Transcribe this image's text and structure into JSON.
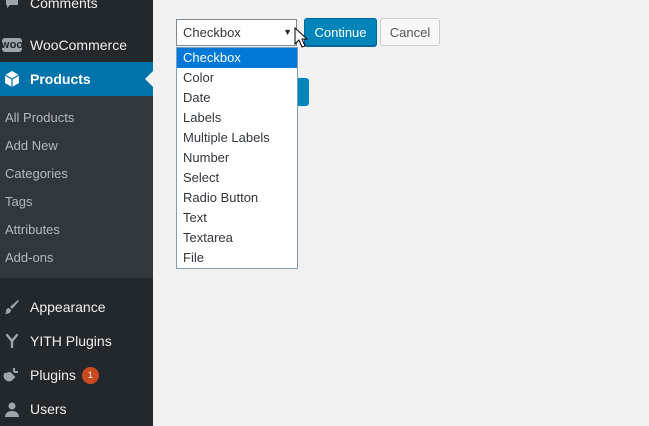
{
  "sidebar": {
    "comments_label": "Comments",
    "woocommerce_label": "WooCommerce",
    "woo_icon_text": "WOO",
    "products_label": "Products",
    "submenu": [
      "All Products",
      "Add New",
      "Categories",
      "Tags",
      "Attributes",
      "Add-ons"
    ],
    "appearance_label": "Appearance",
    "yith_label": "YITH Plugins",
    "plugins_label": "Plugins",
    "plugins_badge": "1",
    "users_label": "Users"
  },
  "form": {
    "select_value": "Checkbox",
    "continue_label": "Continue",
    "cancel_label": "Cancel",
    "options": [
      "Checkbox",
      "Color",
      "Date",
      "Labels",
      "Multiple Labels",
      "Number",
      "Select",
      "Radio Button",
      "Text",
      "Textarea",
      "File"
    ],
    "selected_index": 0
  },
  "colors": {
    "accent": "#0073aa",
    "button": "#0085ba",
    "sidebar_bg": "#23282d",
    "badge": "#ca4a1f"
  }
}
